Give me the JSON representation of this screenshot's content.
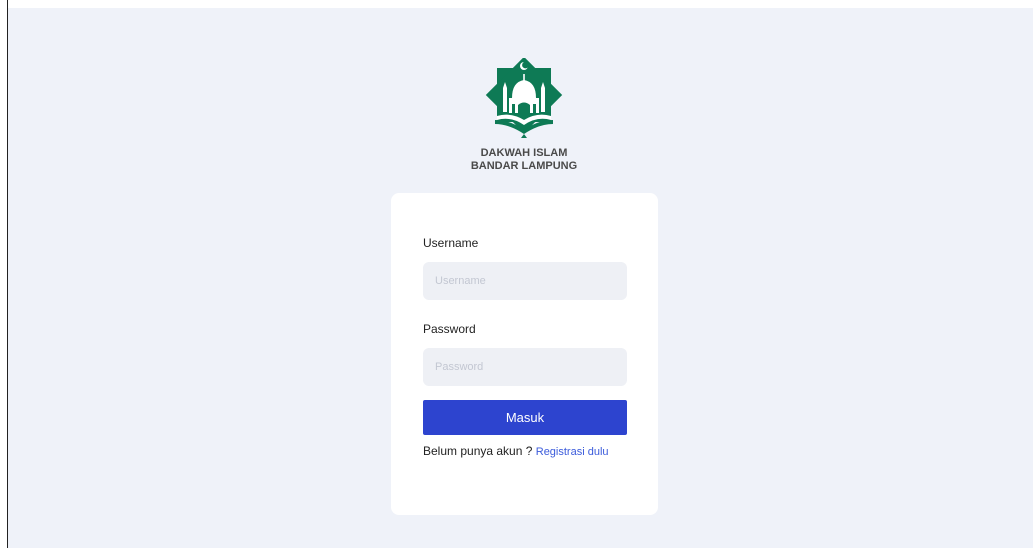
{
  "brand": {
    "logo_icon": "mosque-logo-icon",
    "line1": "DAKWAH ISLAM",
    "line2": "BANDAR LAMPUNG",
    "logo_color": "#0e7a55"
  },
  "login": {
    "username_label": "Username",
    "username_placeholder": "Username",
    "username_value": "",
    "password_label": "Password",
    "password_placeholder": "Password",
    "password_value": "",
    "submit_label": "Masuk",
    "signup_prompt": "Belum punya akun ? ",
    "signup_link": "Registrasi dulu",
    "accent": "#2d44cf"
  }
}
